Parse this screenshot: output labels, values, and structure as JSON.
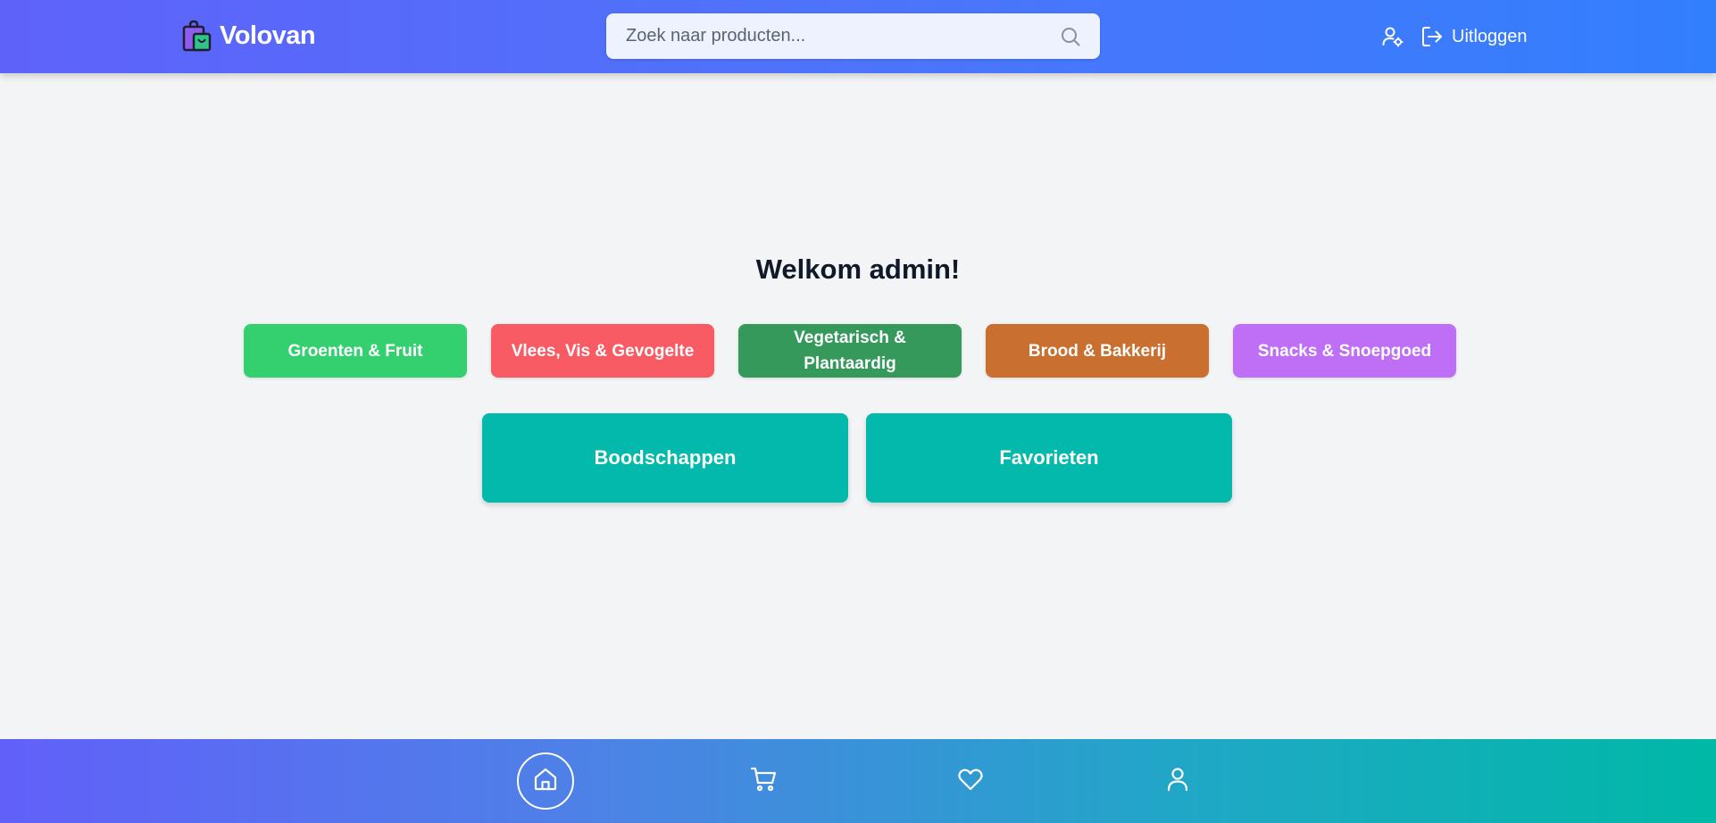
{
  "header": {
    "logo_text": "Volovan",
    "search_placeholder": "Zoek naar producten...",
    "logout_label": "Uitloggen"
  },
  "main": {
    "welcome": "Welkom admin!",
    "categories": [
      {
        "label": "Groenten & Fruit",
        "color": "#34d070"
      },
      {
        "label": "Vlees, Vis & Gevogelte",
        "color": "#f85b63"
      },
      {
        "label": "Vegetarisch & Plantaardig",
        "color": "#34995a"
      },
      {
        "label": "Brood & Bakkerij",
        "color": "#c96f30"
      },
      {
        "label": "Snacks & Snoepgoed",
        "color": "#bf6ef6"
      }
    ],
    "actions": [
      {
        "label": "Boodschappen"
      },
      {
        "label": "Favorieten"
      }
    ],
    "action_color": "#02b9ab"
  },
  "bottom_nav": {
    "items": [
      {
        "icon": "home-icon",
        "active": true
      },
      {
        "icon": "cart-icon",
        "active": false
      },
      {
        "icon": "heart-icon",
        "active": false
      },
      {
        "icon": "user-icon",
        "active": false
      }
    ]
  },
  "colors": {
    "header_gradient_start": "#5f62f9",
    "header_gradient_end": "#327ffd",
    "background": "#f3f4f6"
  }
}
